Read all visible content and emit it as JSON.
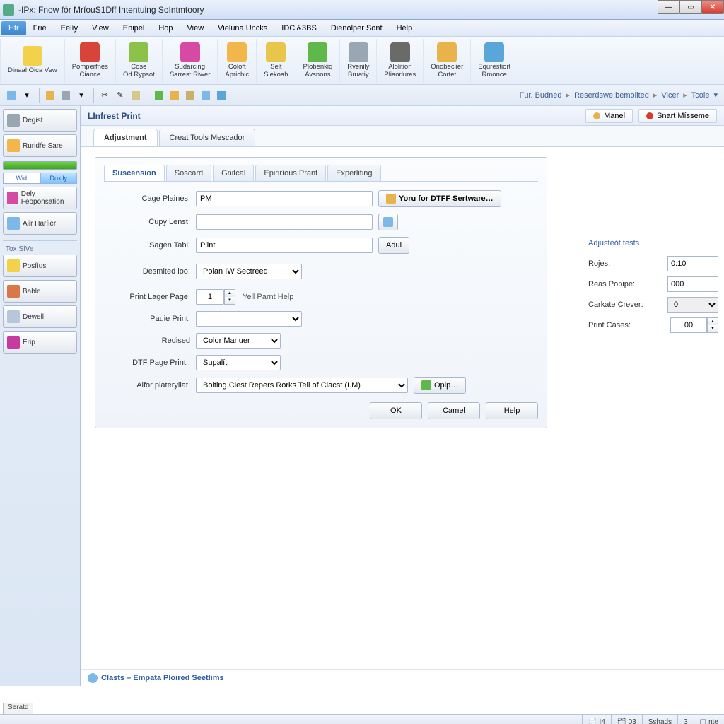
{
  "window": {
    "title": "-IPx: Fnow fór MríouS1Dff Intentuing SoIntmtoory"
  },
  "menubar": [
    "Htr",
    "Frie",
    "Eelíy",
    "View",
    "Enipel",
    "Hop",
    "View",
    "Vieluna Uncks",
    "IDCi&3BS",
    "Dienolper Sont",
    "Help"
  ],
  "ribbon": [
    {
      "label": "Dinaal Oica Vew",
      "sub": "",
      "color": "#f2d24a"
    },
    {
      "label": "Pomperfnes",
      "sub": "Ciance",
      "color": "#d9443a"
    },
    {
      "label": "Cose",
      "sub": "Od Rypsot",
      "color": "#8cc24a"
    },
    {
      "label": "Sudarcing",
      "sub": "Sarres: Riwer",
      "color": "#d64aa4"
    },
    {
      "label": "Coloft",
      "sub": "Apricbic",
      "color": "#f2b64a"
    },
    {
      "label": "Selt",
      "sub": "Slekoah",
      "color": "#e8c64a"
    },
    {
      "label": "Plobenkiq",
      "sub": "Avsnons",
      "color": "#5fb84a"
    },
    {
      "label": "Rvenily",
      "sub": "Bruatiy",
      "color": "#9aa6b2"
    },
    {
      "label": "Alolition",
      "sub": "Pliaorlures",
      "color": "#6a6a6a"
    },
    {
      "label": "Onobeciier",
      "sub": "Cortet",
      "color": "#e8b34a"
    },
    {
      "label": "Equrestiort",
      "sub": "Rmonce",
      "color": "#5aa6d8"
    }
  ],
  "breadcrumb": [
    "Fur. Budned",
    "Reserdswe:bemolited",
    "Vicer",
    "Tcole"
  ],
  "sidebar": {
    "top_label": "Degist",
    "items_a": [
      {
        "label": "Ruridŕe Sare",
        "color": "#f2b64a"
      }
    ],
    "toggle_options": [
      "Wid",
      "Doxily"
    ],
    "items_b": [
      {
        "label": "Dely Feoponsation",
        "color": "#d64aa4"
      },
      {
        "label": "Alir Haríier",
        "color": "#7db9e8"
      }
    ],
    "group2_label": "Tox SíVe",
    "items_c": [
      {
        "label": "Posíìus",
        "color": "#f2d24a"
      },
      {
        "label": "Bable",
        "color": "#d97748"
      },
      {
        "label": "Dewell",
        "color": "#b8c6db"
      },
      {
        "label": "Erip",
        "color": "#c73aa0"
      }
    ]
  },
  "page": {
    "title": "LInfrest Print",
    "chip1": "Manel",
    "chip2": "Snart Mísseme"
  },
  "maintabs": [
    "Adjustment",
    "Creat Tools Mescador"
  ],
  "subtabs": [
    "Suscension",
    "Soscard",
    "Gnitcal",
    "Epiriríous Prant",
    "Experliting"
  ],
  "form": {
    "cage_plaines_label": "Cage Plaines:",
    "cage_plaines_value": "PM",
    "dtff_btn": "Yoru for DTFF Sertware…",
    "cupy_lenst_label": "Cupy Lenst:",
    "cupy_lenst_value": "",
    "sagen_tabl_label": "Sagen Tabl:",
    "sagen_tabl_value": "Piint",
    "add_btn": "Adul",
    "desmited_label": "Desmited loo:",
    "desmited_value": "Polan IW Sectreed",
    "print_lager_label": "Print Lager Page:",
    "print_lager_value": "1",
    "yell_parnt": "Yell Parnt Help",
    "pauie_print_label": "Pauie Print:",
    "pauie_print_value": "",
    "redised_label": "Redised",
    "redised_value": "Color Manuer",
    "dtf_page_label": "DTF Page Print::",
    "dtf_page_value": "Supalít",
    "alfor_label": "Alfor plateryliat:",
    "alfor_value": "Bolting Clest Repers Rorks Tell of Clacst (I.M)",
    "opip_btn": "Opip…",
    "ok": "OK",
    "cancel": "Camel",
    "help": "Help"
  },
  "adjust": {
    "title": "Adjusteót tests",
    "rojes_label": "Rojes:",
    "rojes_value": "0:10",
    "reas_label": "Reas Popipe:",
    "reas_value": "000",
    "carkate_label": "Carkate Crever:",
    "carkate_value": "0",
    "printcases_label": "Print Cases:",
    "printcases_value": "00"
  },
  "contentstatus": "Clasts – Empata PIoired Seetlims",
  "statusbar": {
    "tab": "Seratd",
    "cell1": "I4",
    "cell2": "03",
    "cell3": "Sshads",
    "cell4": "3",
    "cell5": "nte"
  }
}
